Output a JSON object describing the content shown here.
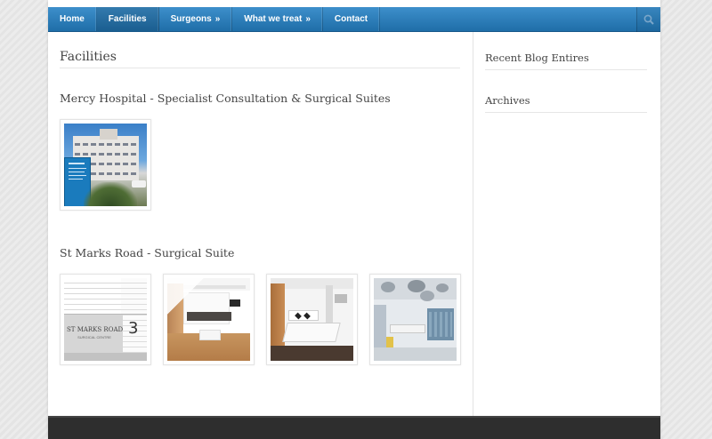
{
  "nav": {
    "items": [
      {
        "label": "Home",
        "active": false,
        "has_submenu": false
      },
      {
        "label": "Facilities",
        "active": true,
        "has_submenu": false
      },
      {
        "label": "Surgeons",
        "active": false,
        "has_submenu": true
      },
      {
        "label": "What we treat",
        "active": false,
        "has_submenu": true
      },
      {
        "label": "Contact",
        "active": false,
        "has_submenu": false
      }
    ],
    "submenu_arrow": "»",
    "search_icon": "search-icon",
    "accent_color": "#2b7ab8"
  },
  "main": {
    "title": "Facilities",
    "sections": [
      {
        "title": "Mercy Hospital - Specialist Consultation & Surgical Suites",
        "images": [
          {
            "name": "mercy-hospital-building-photo"
          }
        ]
      },
      {
        "title": "St Marks Road - Surgical Suite",
        "images": [
          {
            "name": "st-marks-road-sign-photo",
            "sign_text": "ST MARKS ROAD",
            "sign_subtext": "SURGICAL CENTRE",
            "sign_number": "3"
          },
          {
            "name": "recovery-lounge-photo"
          },
          {
            "name": "patient-bay-photo"
          },
          {
            "name": "operating-theatre-photo"
          }
        ]
      }
    ]
  },
  "sidebar": {
    "widgets": [
      {
        "title": "Recent Blog Entires"
      },
      {
        "title": "Archives"
      }
    ]
  }
}
